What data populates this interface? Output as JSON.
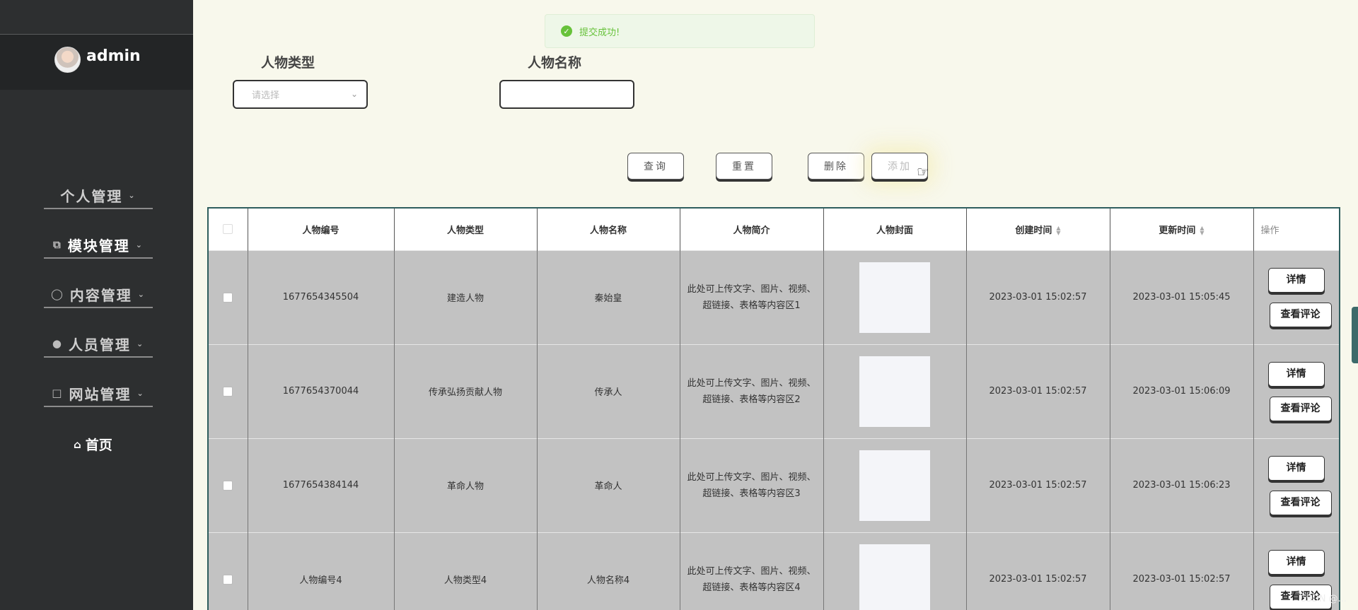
{
  "user": {
    "name": "admin"
  },
  "toast": {
    "message": "提交成功!"
  },
  "menu": {
    "items": [
      {
        "label": "个人管理",
        "icon": "user-icon"
      },
      {
        "label": "模块管理",
        "icon": "copy-icon"
      },
      {
        "label": "内容管理",
        "icon": "chat-icon"
      },
      {
        "label": "人员管理",
        "icon": "person-icon"
      },
      {
        "label": "网站管理",
        "icon": "monitor-icon"
      }
    ],
    "home": {
      "label": "首页",
      "icon": "home-icon"
    }
  },
  "search": {
    "type_label": "人物类型",
    "type_placeholder": "请选择",
    "name_label": "人物名称",
    "name_value": ""
  },
  "actions": {
    "query": "查询",
    "reset": "重置",
    "delete": "删除",
    "add": "添加"
  },
  "table": {
    "headers": [
      "人物编号",
      "人物类型",
      "人物名称",
      "人物简介",
      "人物封面",
      "创建时间",
      "更新时间",
      "操作"
    ],
    "row_buttons": {
      "detail": "详情",
      "comments": "查看评论"
    },
    "rows": [
      {
        "id": "1677654345504",
        "type": "建造人物",
        "name": "秦始皇",
        "desc": "此处可上传文字、图片、视频、超链接、表格等内容区1",
        "created": "2023-03-01 15:02:57",
        "updated": "2023-03-01 15:05:45"
      },
      {
        "id": "1677654370044",
        "type": "传承弘扬贡献人物",
        "name": "传承人",
        "desc": "此处可上传文字、图片、视频、超链接、表格等内容区2",
        "created": "2023-03-01 15:02:57",
        "updated": "2023-03-01 15:06:09"
      },
      {
        "id": "1677654384144",
        "type": "革命人物",
        "name": "革命人",
        "desc": "此处可上传文字、图片、视频、超链接、表格等内容区3",
        "created": "2023-03-01 15:02:57",
        "updated": "2023-03-01 15:06:23"
      },
      {
        "id": "人物编号4",
        "type": "人物类型4",
        "name": "人物名称4",
        "desc": "此处可上传文字、图片、视频、超链接、表格等内容区4",
        "created": "2023-03-01 15:02:57",
        "updated": "2023-03-01 15:02:57"
      }
    ]
  },
  "watermark": "CSDN @..."
}
